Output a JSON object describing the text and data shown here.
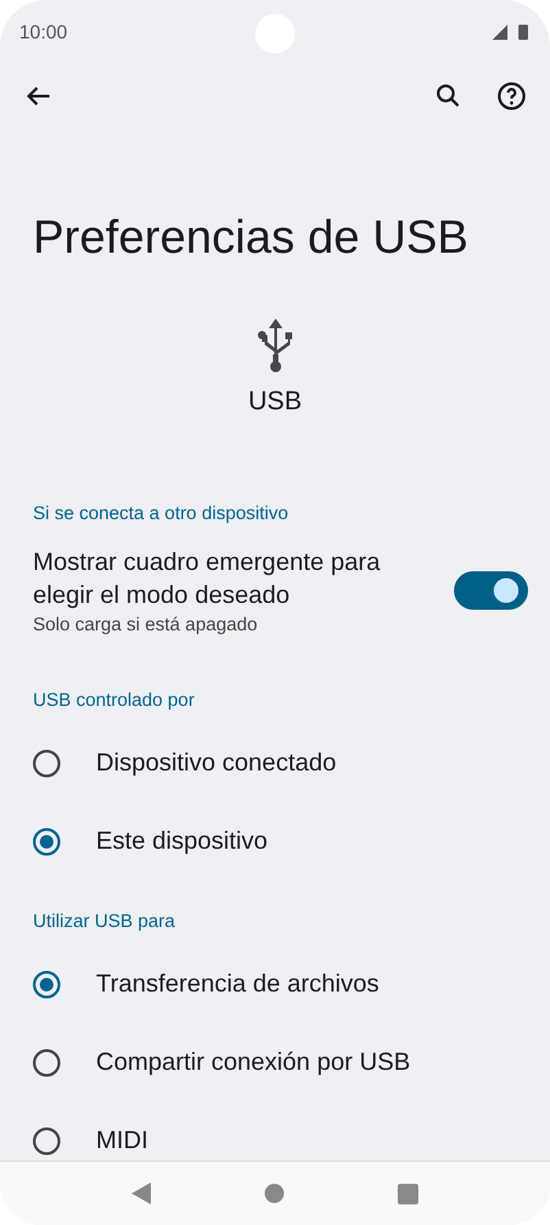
{
  "status_bar": {
    "time": "10:00"
  },
  "title": "Preferencias de USB",
  "hero": {
    "label": "USB"
  },
  "sections": [
    {
      "header": "Si se conecta a otro dispositivo",
      "items": [
        {
          "kind": "toggle",
          "label": "Mostrar cuadro emergente para elegir el modo deseado",
          "summary": "Solo carga si está apagado",
          "on": true
        }
      ]
    },
    {
      "header": "USB controlado por",
      "items": [
        {
          "kind": "radio",
          "label": "Dispositivo conectado",
          "selected": false
        },
        {
          "kind": "radio",
          "label": "Este dispositivo",
          "selected": true
        }
      ]
    },
    {
      "header": "Utilizar USB para",
      "items": [
        {
          "kind": "radio",
          "label": "Transferencia de archivos",
          "selected": true
        },
        {
          "kind": "radio",
          "label": "Compartir conexión por USB",
          "selected": false
        },
        {
          "kind": "radio",
          "label": "MIDI",
          "selected": false
        }
      ]
    }
  ]
}
